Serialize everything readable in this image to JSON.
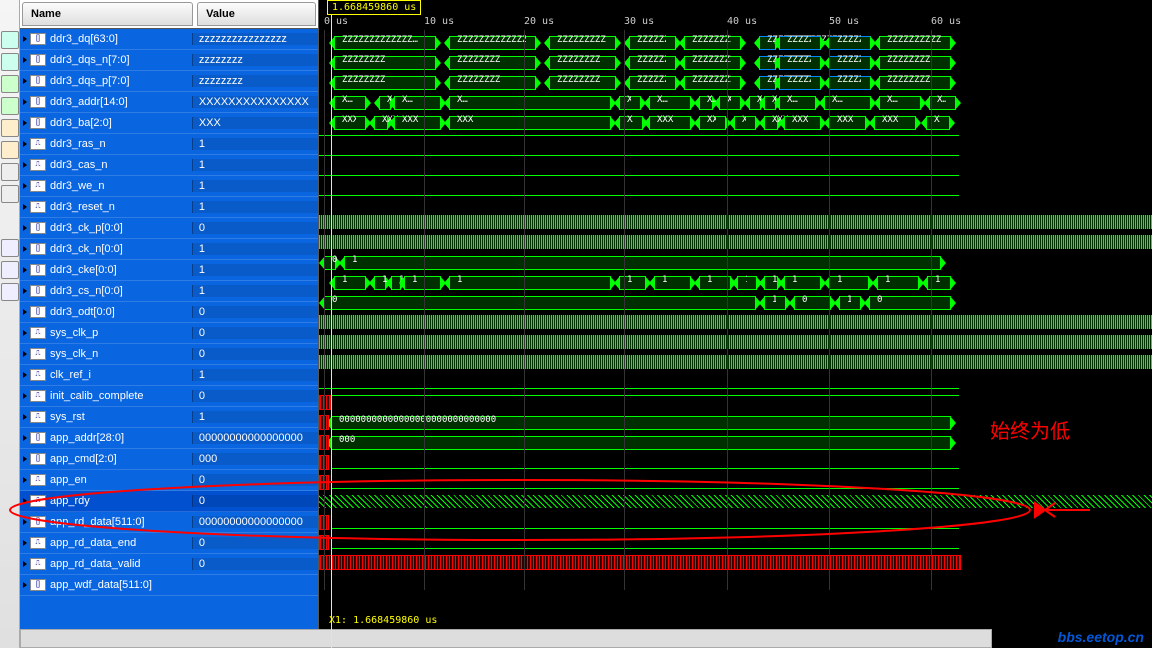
{
  "cursor_label": "1.668459860 us",
  "footer_label": "X1: 1.668459860 us",
  "headers": {
    "name": "Name",
    "value": "Value"
  },
  "ticks": [
    "0 us",
    "10 us",
    "20 us",
    "30 us",
    "40 us",
    "50 us",
    "60 us"
  ],
  "annotation": "始终为低",
  "watermark": "bbs.eetop.cn",
  "signals": [
    {
      "name": "ddr3_dq[63:0]",
      "value": "zzzzzzzzzzzzzzzz",
      "icon": "[]"
    },
    {
      "name": "ddr3_dqs_n[7:0]",
      "value": "zzzzzzzz",
      "icon": "[]"
    },
    {
      "name": "ddr3_dqs_p[7:0]",
      "value": "zzzzzzzz",
      "icon": "[]"
    },
    {
      "name": "ddr3_addr[14:0]",
      "value": "XXXXXXXXXXXXXXX",
      "icon": "[]"
    },
    {
      "name": "ddr3_ba[2:0]",
      "value": "XXX",
      "icon": "[]"
    },
    {
      "name": "ddr3_ras_n",
      "value": "1",
      "icon": "⎍"
    },
    {
      "name": "ddr3_cas_n",
      "value": "1",
      "icon": "⎍"
    },
    {
      "name": "ddr3_we_n",
      "value": "1",
      "icon": "⎍"
    },
    {
      "name": "ddr3_reset_n",
      "value": "1",
      "icon": "⎍"
    },
    {
      "name": "ddr3_ck_p[0:0]",
      "value": "0",
      "icon": "[]"
    },
    {
      "name": "ddr3_ck_n[0:0]",
      "value": "1",
      "icon": "[]"
    },
    {
      "name": "ddr3_cke[0:0]",
      "value": "1",
      "icon": "[]"
    },
    {
      "name": "ddr3_cs_n[0:0]",
      "value": "1",
      "icon": "[]"
    },
    {
      "name": "ddr3_odt[0:0]",
      "value": "0",
      "icon": "[]"
    },
    {
      "name": "sys_clk_p",
      "value": "0",
      "icon": "⎍"
    },
    {
      "name": "sys_clk_n",
      "value": "0",
      "icon": "⎍"
    },
    {
      "name": "clk_ref_i",
      "value": "1",
      "icon": "⎍"
    },
    {
      "name": "init_calib_complete",
      "value": "0",
      "icon": "⎍"
    },
    {
      "name": "sys_rst",
      "value": "1",
      "icon": "⎍"
    },
    {
      "name": "app_addr[28:0]",
      "value": "00000000000000000",
      "icon": "[]"
    },
    {
      "name": "app_cmd[2:0]",
      "value": "000",
      "icon": "[]"
    },
    {
      "name": "app_en",
      "value": "0",
      "icon": "⎍"
    },
    {
      "name": "app_rdy",
      "value": "0",
      "icon": "⎍",
      "hl": true
    },
    {
      "name": "app_rd_data[511:0]",
      "value": "00000000000000000",
      "icon": "[]"
    },
    {
      "name": "app_rd_data_end",
      "value": "0",
      "icon": "⎍"
    },
    {
      "name": "app_rd_data_valid",
      "value": "0",
      "icon": "⎍"
    },
    {
      "name": "app_wdf_data[511:0]",
      "value": "",
      "icon": "[]"
    }
  ],
  "wave_bus_text": {
    "ddr3_dq": "ZZZZZZZZZZZZZ…",
    "ddr3_dqs": "ZZZZZZZZ",
    "ddr3_addr": "XXXXXXXXXXXXXXX",
    "zero_long": "00000000000000000000000000000",
    "triple_zero": "000"
  },
  "tool_icons": [
    "🔍",
    "🔍",
    "⟲",
    "▶",
    "↩",
    "←",
    "→",
    "⊞",
    "⊟",
    "⊡",
    "⊡",
    "⊡"
  ]
}
